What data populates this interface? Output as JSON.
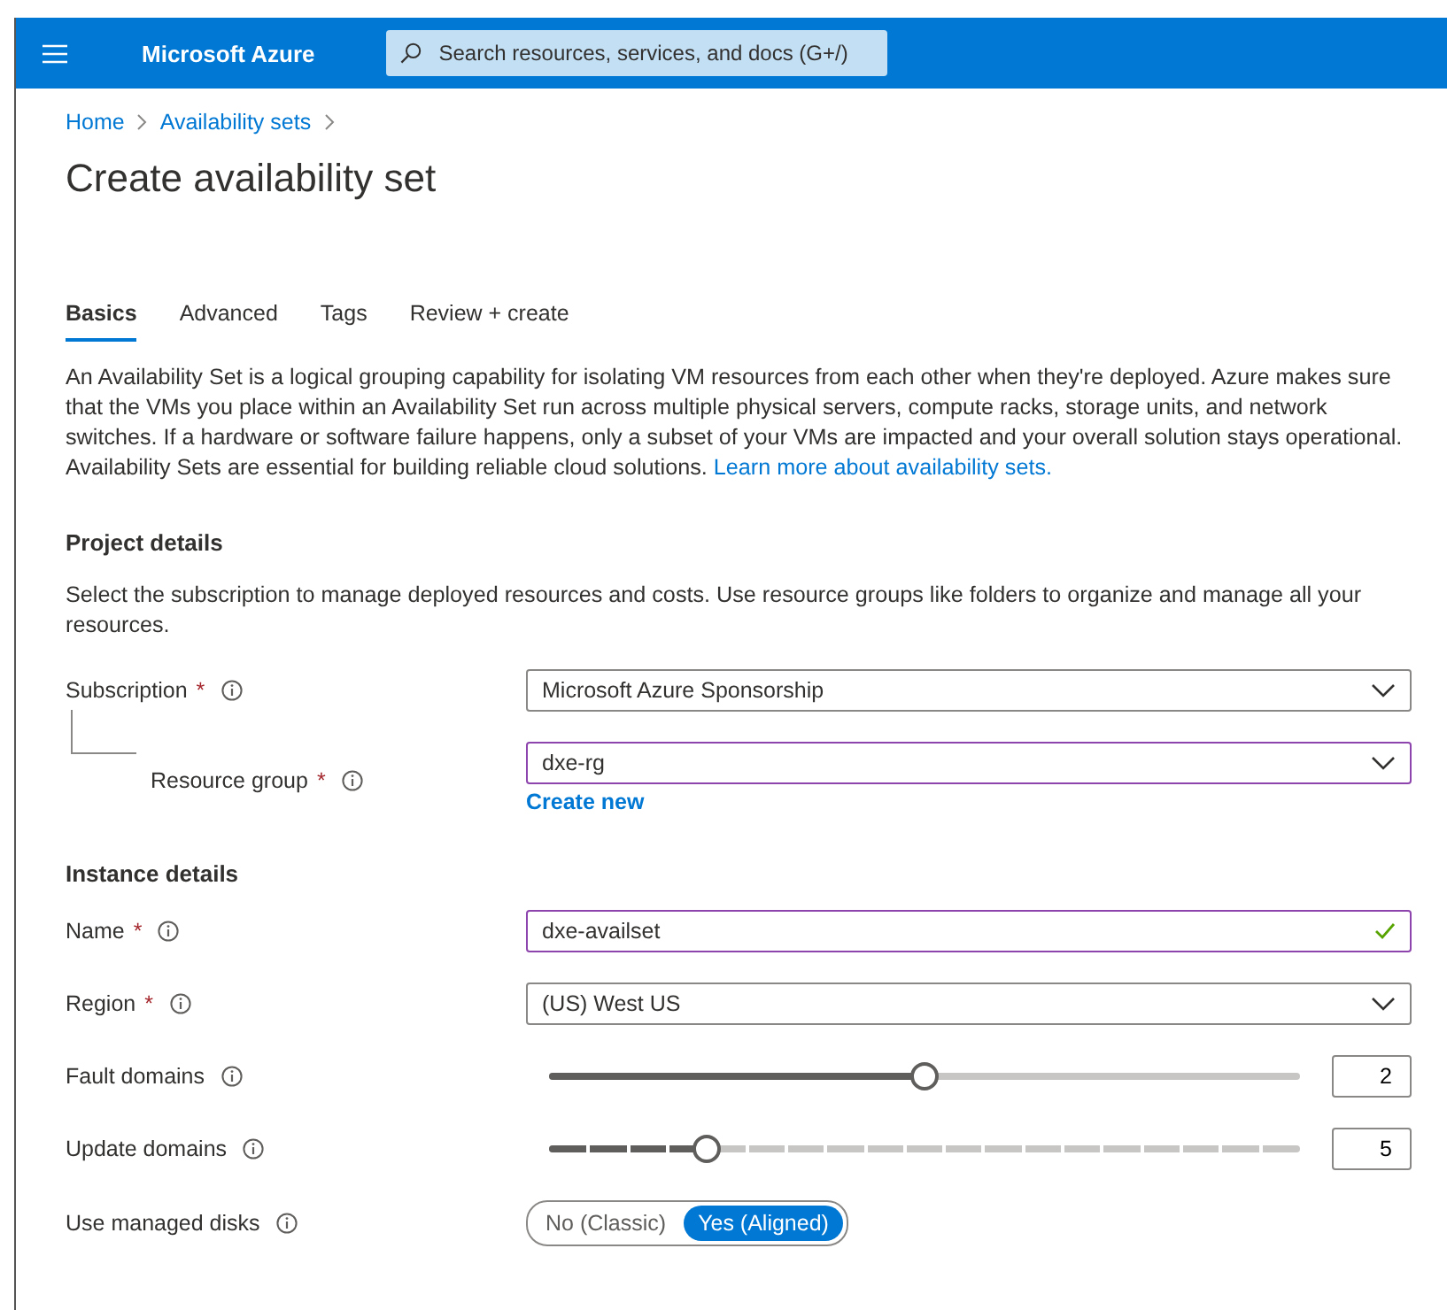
{
  "header": {
    "brand": "Microsoft Azure",
    "search": {
      "placeholder": "Search resources, services, and docs (G+/)"
    }
  },
  "breadcrumb": [
    "Home",
    "Availability sets"
  ],
  "page_title": "Create availability set",
  "tabs": [
    {
      "label": "Basics",
      "selected": true
    },
    {
      "label": "Advanced",
      "selected": false
    },
    {
      "label": "Tags",
      "selected": false
    },
    {
      "label": "Review + create",
      "selected": false
    }
  ],
  "description": {
    "text": "An Availability Set is a logical grouping capability for isolating VM resources from each other when they're deployed. Azure makes sure that the VMs you place within an Availability Set run across multiple physical servers, compute racks, storage units, and network switches. If a hardware or software failure happens, only a subset of your VMs are impacted and your overall solution stays operational. Availability Sets are essential for building reliable cloud solutions.",
    "link": "Learn more about availability sets."
  },
  "sections": [
    {
      "title": "Project details",
      "text": "Select the subscription to manage deployed resources and costs. Use resource groups like folders to organize and manage all your resources.",
      "fields": [
        {
          "kind": "dropdown",
          "label": "Subscription",
          "required_mark": "*",
          "value": "Microsoft Azure Sponsorship",
          "highlighted": false,
          "nested": false
        },
        {
          "kind": "dropdown",
          "label": "Resource group",
          "required_mark": "*",
          "value": "dxe-rg",
          "highlighted": true,
          "nested": true,
          "action": "Create new"
        }
      ]
    },
    {
      "title": "Instance details",
      "fields": [
        {
          "kind": "text",
          "label": "Name",
          "required_mark": "*",
          "value": "dxe-availset",
          "highlighted": true,
          "valid": true
        },
        {
          "kind": "dropdown",
          "label": "Region",
          "required_mark": "*",
          "value": "(US) West US",
          "highlighted": false,
          "nested": false
        },
        {
          "kind": "slider",
          "label": "Fault domains",
          "level": 0.5,
          "value": "2"
        },
        {
          "kind": "stepped-slider",
          "label": "Update domains",
          "level": 0.21,
          "value": "5"
        },
        {
          "kind": "toggle",
          "label": "Use managed disks",
          "options": [
            {
              "label": "No (Classic)",
              "selected": false
            },
            {
              "label": "Yes (Aligned)",
              "selected": true
            }
          ]
        }
      ]
    }
  ]
}
